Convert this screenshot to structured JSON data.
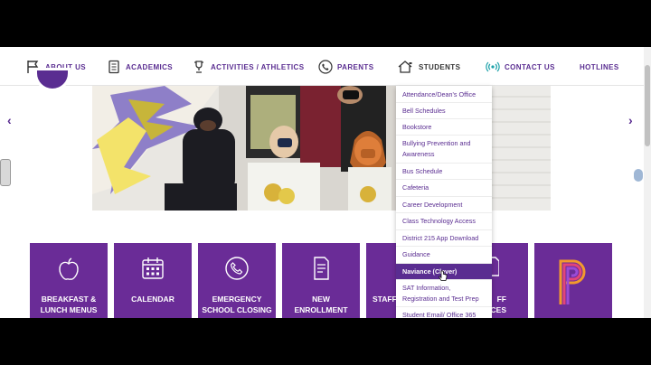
{
  "nav": {
    "items": [
      {
        "label": "ABOUT US",
        "icon": "flag-icon"
      },
      {
        "label": "ACADEMICS",
        "icon": "notebook-icon"
      },
      {
        "label": "ACTIVITIES / ATHLETICS",
        "icon": "trophy-icon"
      },
      {
        "label": "PARENTS",
        "icon": "phone-icon"
      },
      {
        "label": "STUDENTS",
        "icon": "house-icon"
      },
      {
        "label": "CONTACT US",
        "icon": "broadcast-icon"
      },
      {
        "label": "HOTLINES",
        "icon": ""
      }
    ]
  },
  "hero": {
    "prev_label": "‹",
    "next_label": "›"
  },
  "tiles": [
    {
      "label_line1": "BREAKFAST &",
      "label_line2": "LUNCH MENUS",
      "icon": "apple-icon"
    },
    {
      "label_line1": "CALENDAR",
      "label_line2": "",
      "icon": "calendar-icon"
    },
    {
      "label_line1": "EMERGENCY",
      "label_line2": "SCHOOL CLOSING",
      "icon": "phone-icon"
    },
    {
      "label_line1": "NEW",
      "label_line2": "ENROLLMENT",
      "icon": "document-icon"
    },
    {
      "label_line1": "STAFF",
      "label_line2": "",
      "icon": ""
    },
    {
      "label_line1": "FF",
      "label_line2": "RCES",
      "icon": "document-icon"
    },
    {
      "label_line1": "",
      "label_line2": "",
      "icon": "powerschool-logo"
    }
  ],
  "dropdown": {
    "items": [
      {
        "label": "Attendance/Dean's Office"
      },
      {
        "label": "Bell Schedules"
      },
      {
        "label": "Bookstore"
      },
      {
        "label": "Bullying Prevention and Awareness"
      },
      {
        "label": "Bus Schedule"
      },
      {
        "label": "Cafeteria"
      },
      {
        "label": "Career Development"
      },
      {
        "label": "Class Technology Access"
      },
      {
        "label": "District 215 App Download"
      },
      {
        "label": "Guidance"
      },
      {
        "label": "Naviance (Clever)"
      },
      {
        "label": "SAT Information, Registration and Test Prep"
      },
      {
        "label": "Student Email/ Office 365"
      }
    ],
    "active_index": 10
  },
  "colors": {
    "brand_purple": "#5a2d91",
    "tile_purple": "#6a2c97",
    "contact_teal": "#1aa0a8"
  }
}
